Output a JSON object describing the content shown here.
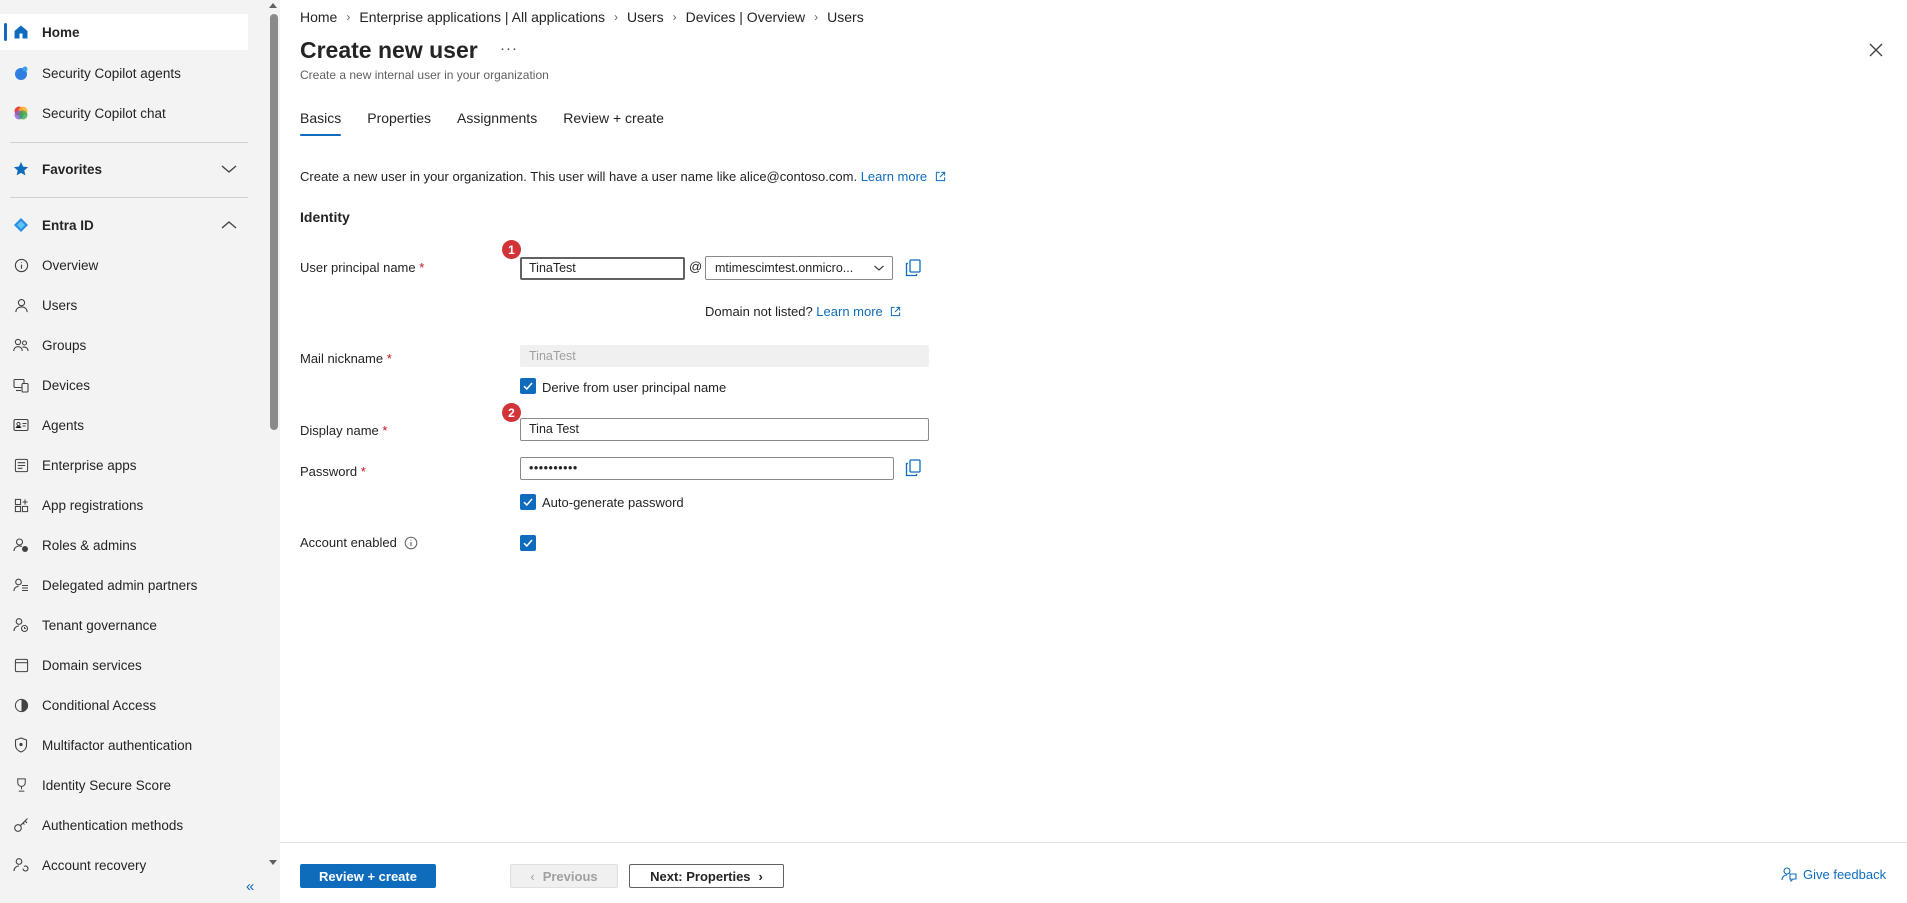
{
  "sidebar": {
    "items": [
      {
        "label": "Home",
        "icon": "home-icon"
      },
      {
        "label": "Security Copilot agents",
        "icon": "copilot-agents-icon"
      },
      {
        "label": "Security Copilot chat",
        "icon": "copilot-chat-icon"
      },
      {
        "label": "Favorites",
        "icon": "star-icon"
      },
      {
        "label": "Entra ID",
        "icon": "entra-id-icon"
      },
      {
        "label": "Overview",
        "icon": "info-icon"
      },
      {
        "label": "Users",
        "icon": "user-icon"
      },
      {
        "label": "Groups",
        "icon": "groups-icon"
      },
      {
        "label": "Devices",
        "icon": "devices-icon"
      },
      {
        "label": "Agents",
        "icon": "agents-icon"
      },
      {
        "label": "Enterprise apps",
        "icon": "enterprise-apps-icon"
      },
      {
        "label": "App registrations",
        "icon": "app-registrations-icon"
      },
      {
        "label": "Roles & admins",
        "icon": "roles-icon"
      },
      {
        "label": "Delegated admin partners",
        "icon": "partners-icon"
      },
      {
        "label": "Tenant governance",
        "icon": "tenant-governance-icon"
      },
      {
        "label": "Domain services",
        "icon": "domain-services-icon"
      },
      {
        "label": "Conditional Access",
        "icon": "conditional-access-icon"
      },
      {
        "label": "Multifactor authentication",
        "icon": "shield-icon"
      },
      {
        "label": "Identity Secure Score",
        "icon": "trophy-icon"
      },
      {
        "label": "Authentication methods",
        "icon": "key-icon"
      },
      {
        "label": "Account recovery",
        "icon": "account-recovery-icon"
      }
    ]
  },
  "breadcrumb": [
    "Home",
    "Enterprise applications | All applications",
    "Users",
    "Devices | Overview",
    "Users"
  ],
  "header": {
    "title": "Create new user",
    "more": "···",
    "subtitle": "Create a new internal user in your organization"
  },
  "tabs": [
    "Basics",
    "Properties",
    "Assignments",
    "Review + create"
  ],
  "intro": {
    "text": "Create a new user in your organization. This user will have a user name like alice@contoso.com.",
    "link": "Learn more"
  },
  "identity": {
    "heading": "Identity",
    "upn_label": "User principal name",
    "upn_value": "TinaTest",
    "at": "@",
    "domain_value": "mtimescimtest.onmicro...",
    "domain_note": "Domain not listed?",
    "domain_link": "Learn more",
    "mail_label": "Mail nickname",
    "mail_value": "TinaTest",
    "derive_label": "Derive from user principal name",
    "display_label": "Display name",
    "display_value": "Tina Test",
    "password_label": "Password",
    "password_value": "••••••••••",
    "autogen_label": "Auto-generate password",
    "enabled_label": "Account enabled",
    "required": "*",
    "badge1": "1",
    "badge2": "2"
  },
  "footer": {
    "review_create": "Review + create",
    "previous": "Previous",
    "next": "Next: Properties",
    "feedback": "Give feedback"
  },
  "colors": {
    "accent": "#0f6cbd",
    "required": "#c50f1f",
    "badge": "#d13438",
    "sidebar_bg": "#f3f3f3"
  }
}
